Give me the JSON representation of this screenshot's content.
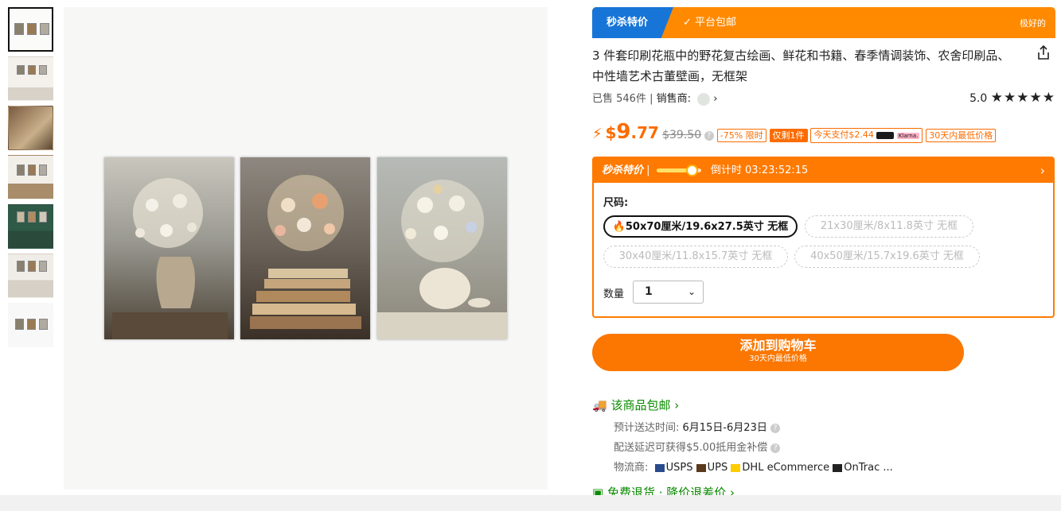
{
  "flash": {
    "tag": "秒杀特价",
    "free_shipping": "平台包邮",
    "badge": "极好的"
  },
  "product": {
    "title": "3 件套印刷花瓶中的野花复古绘画、鲜花和书籍、春季情调装饰、农舍印刷品、中性墙艺术古董壁画，无框架",
    "sold": "已售 546件",
    "seller_label": "销售商:",
    "rating": "5.0",
    "stars": "★★★★★"
  },
  "price": {
    "currency": "$",
    "int": "9",
    "dec": ".77",
    "original": "$39.50",
    "discount": "-75% 限时",
    "stock": "仅剩1件",
    "installment": "今天支付$2.44",
    "klarna": "Klarna.",
    "lowest": "30天内最低价格"
  },
  "flash_sale": {
    "label": "秒杀特价",
    "countdown_label": "倒计时",
    "countdown": "03:23:52:15",
    "progress": 0.75
  },
  "sku": {
    "size_label": "尺码:",
    "options": [
      {
        "label": "50x70厘米/19.6x27.5英寸 无框",
        "selected": true
      },
      {
        "label": "21x30厘米/8x11.8英寸 无框",
        "selected": false
      },
      {
        "label": "30x40厘米/11.8x15.7英寸 无框",
        "selected": false
      },
      {
        "label": "40x50厘米/15.7x19.6英寸 无框",
        "selected": false
      }
    ],
    "qty_label": "数量",
    "qty_value": "1"
  },
  "cart": {
    "label": "添加到购物车",
    "sub": "30天内最低价格"
  },
  "shipping": {
    "title": "该商品包邮",
    "eta_label": "预计送达时间:",
    "eta_value": "6月15日-6月23日",
    "delay": "配送延迟可获得$5.00抵用金补偿",
    "carriers_label": "物流商:",
    "carriers": [
      "USPS",
      "UPS",
      "DHL eCommerce",
      "OnTrac ..."
    ],
    "returns": "免费退货 · 降价退差价"
  },
  "colors": {
    "accent": "#fb7701",
    "flash_blue": "#1775d7",
    "ship_green": "#0a8a00"
  },
  "thumbnails": 7
}
